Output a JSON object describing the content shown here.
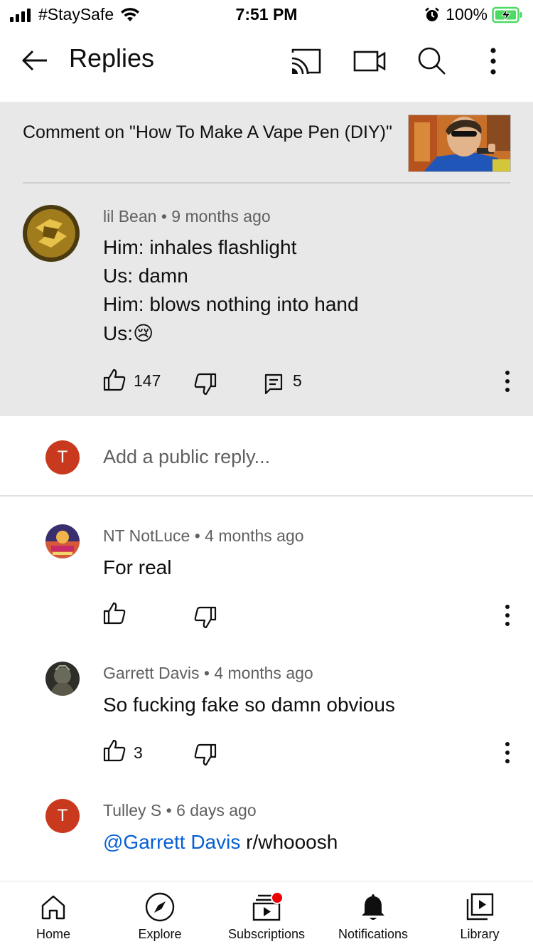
{
  "status_bar": {
    "carrier": "#StaySafe",
    "time": "7:51 PM",
    "battery": "100%"
  },
  "app_bar": {
    "title": "Replies",
    "icons": [
      "back-arrow-icon",
      "cast-icon",
      "video-camera-icon",
      "search-icon",
      "more-vert-icon"
    ]
  },
  "context": {
    "text": "Comment on \"How To Make A Vape Pen (DIY)\""
  },
  "main_comment": {
    "author": "lil Bean",
    "time": "9 months ago",
    "lines": [
      "Him: inhales flashlight",
      "Us: damn",
      "Him: blows nothing into hand",
      "Us:😢"
    ],
    "likes": "147",
    "replies": "5"
  },
  "reply_input": {
    "avatar_letter": "T",
    "placeholder": "Add a public reply..."
  },
  "replies": [
    {
      "author": "NT NotLuce",
      "time": "4 months ago",
      "text": "For real",
      "likes": ""
    },
    {
      "author": "Garrett Davis",
      "time": "4 months ago",
      "text": "So fucking fake so damn obvious",
      "likes": "3"
    },
    {
      "author": "Tulley S",
      "time": "6 days ago",
      "avatar_letter": "T",
      "mention": "@Garrett Davis",
      "text": " r/whooosh"
    }
  ],
  "bottom_nav": {
    "items": [
      {
        "label": "Home",
        "icon": "home-icon"
      },
      {
        "label": "Explore",
        "icon": "compass-icon"
      },
      {
        "label": "Subscriptions",
        "icon": "subscriptions-icon"
      },
      {
        "label": "Notifications",
        "icon": "bell-icon"
      },
      {
        "label": "Library",
        "icon": "library-icon"
      }
    ]
  },
  "colors": {
    "accent_red": "#c9391d",
    "link_blue": "#065fd4",
    "header_gray": "#e8e8e8",
    "battery_green": "#4cd964"
  }
}
